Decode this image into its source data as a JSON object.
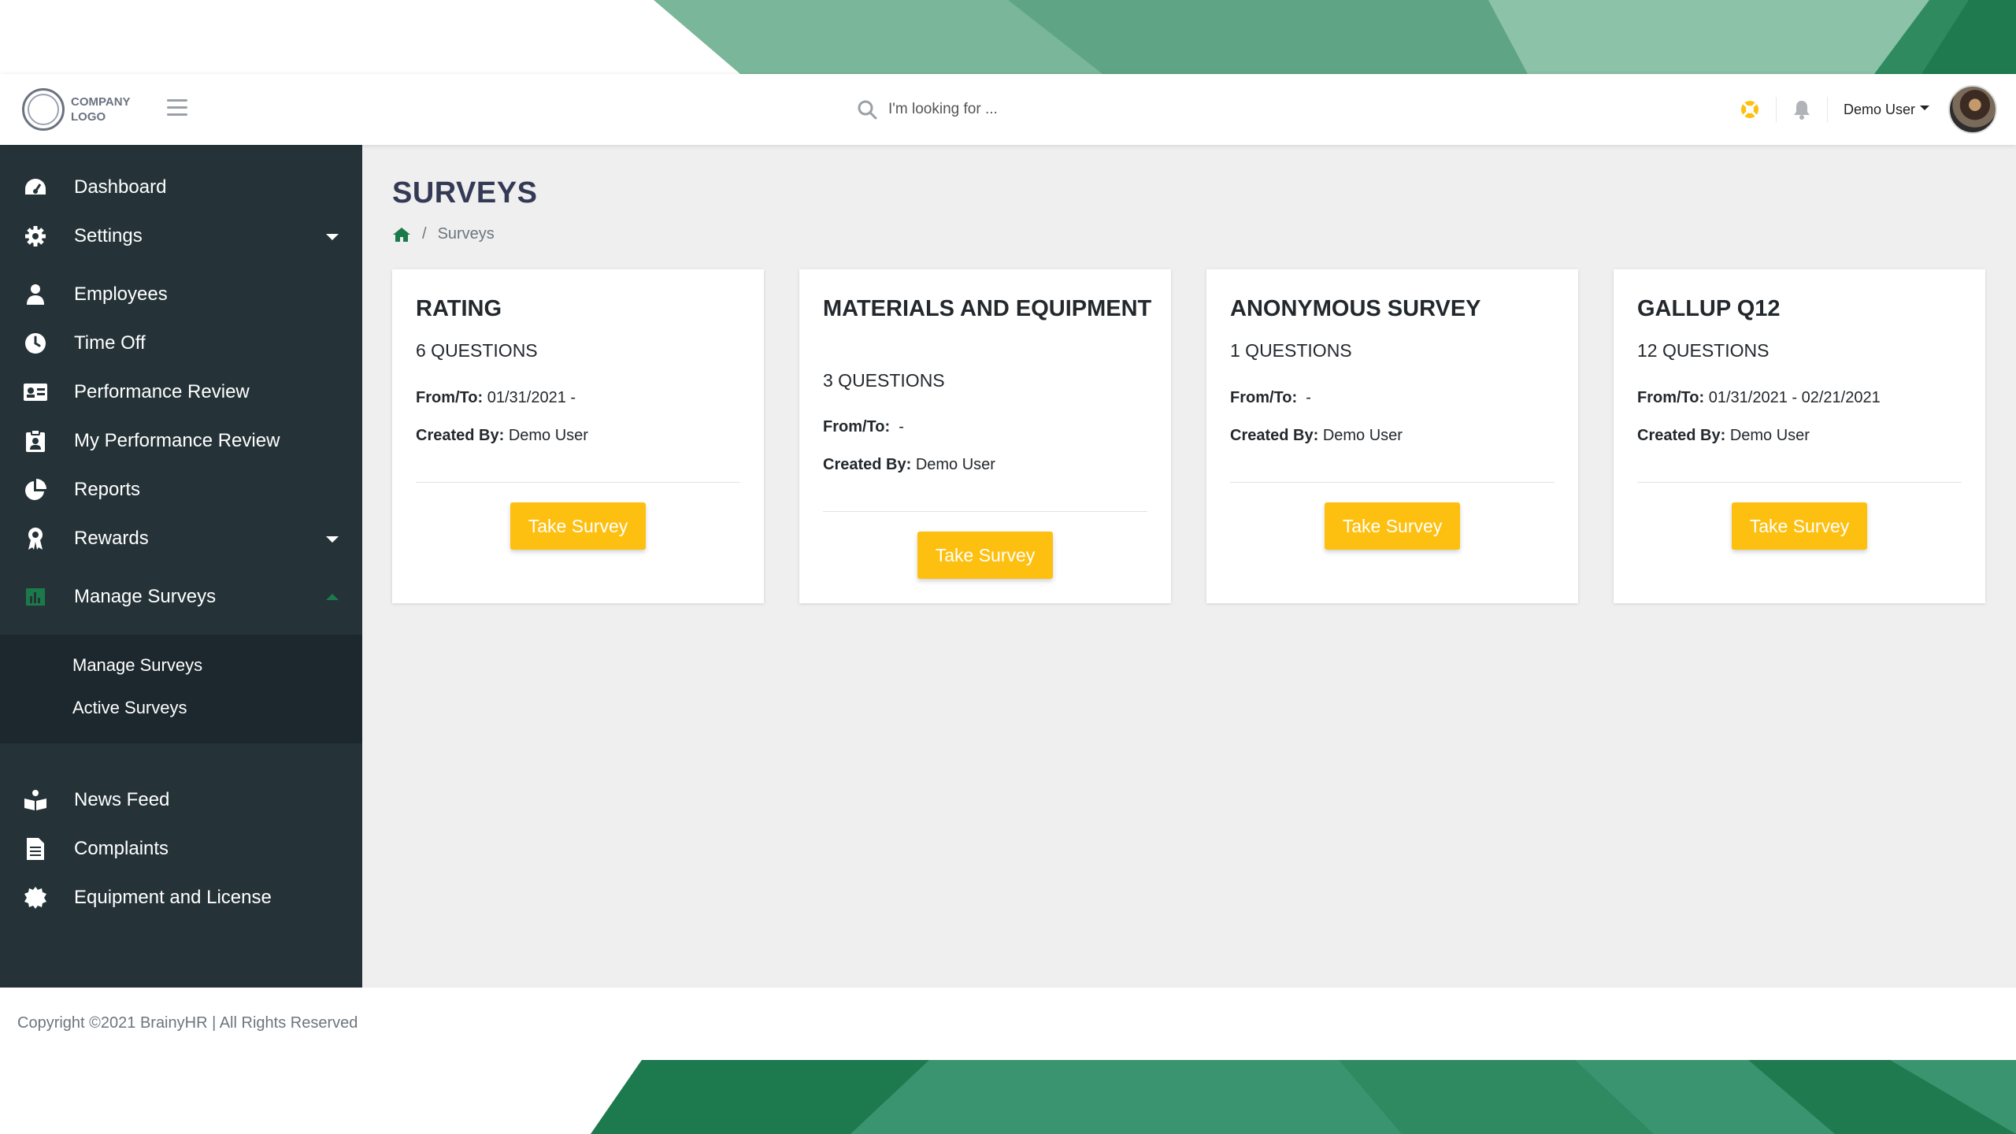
{
  "header": {
    "logo_text": "COMPANY LOGO",
    "search_placeholder": "I'm looking for ...",
    "user_name": "Demo User"
  },
  "sidebar": {
    "items": [
      {
        "label": "Dashboard",
        "icon": "dashboard-icon"
      },
      {
        "label": "Settings",
        "icon": "gear-icon",
        "expandable": true
      },
      {
        "label": "Employees",
        "icon": "employee-icon"
      },
      {
        "label": "Time Off",
        "icon": "clock-icon"
      },
      {
        "label": "Performance Review",
        "icon": "id-card-icon"
      },
      {
        "label": "My Performance Review",
        "icon": "clipboard-user-icon"
      },
      {
        "label": "Reports",
        "icon": "pie-chart-icon"
      },
      {
        "label": "Rewards",
        "icon": "award-icon",
        "expandable": true
      },
      {
        "label": "Manage Surveys",
        "icon": "bar-chart-icon",
        "expanded": true
      },
      {
        "label": "News Feed",
        "icon": "news-icon"
      },
      {
        "label": "Complaints",
        "icon": "document-icon"
      },
      {
        "label": "Equipment and License",
        "icon": "certificate-icon"
      }
    ],
    "submenu": [
      {
        "label": "Manage Surveys"
      },
      {
        "label": "Active Surveys"
      }
    ]
  },
  "main": {
    "title": "SURVEYS",
    "breadcrumb": {
      "separator": "/",
      "current": "Surveys"
    },
    "labels": {
      "from_to": "From/To:",
      "created_by": "Created By:"
    },
    "cards": [
      {
        "title": "RATING",
        "questions": "6 QUESTIONS",
        "from_to": "01/31/2021 -",
        "created_by": "Demo User",
        "button": "Take Survey"
      },
      {
        "title": "MATERIALS AND EQUIPMENT",
        "questions": "3 QUESTIONS",
        "from_to": "-",
        "created_by": "Demo User",
        "button": "Take Survey"
      },
      {
        "title": "ANONYMOUS SURVEY",
        "questions": "1 QUESTIONS",
        "from_to": "-",
        "created_by": "Demo User",
        "button": "Take Survey"
      },
      {
        "title": "GALLUP Q12",
        "questions": "12 QUESTIONS",
        "from_to": "01/31/2021 - 02/21/2021",
        "created_by": "Demo User",
        "button": "Take Survey"
      }
    ]
  },
  "footer": {
    "copyright": "Copyright ©2021 BrainyHR | All Rights Reserved"
  },
  "colors": {
    "sidebar_bg": "#253339",
    "submenu_bg": "#1c282d",
    "main_bg": "#efefef",
    "accent_green": "#1b7a4a",
    "button_yellow": "#fdc010",
    "title_color": "#343a55"
  }
}
